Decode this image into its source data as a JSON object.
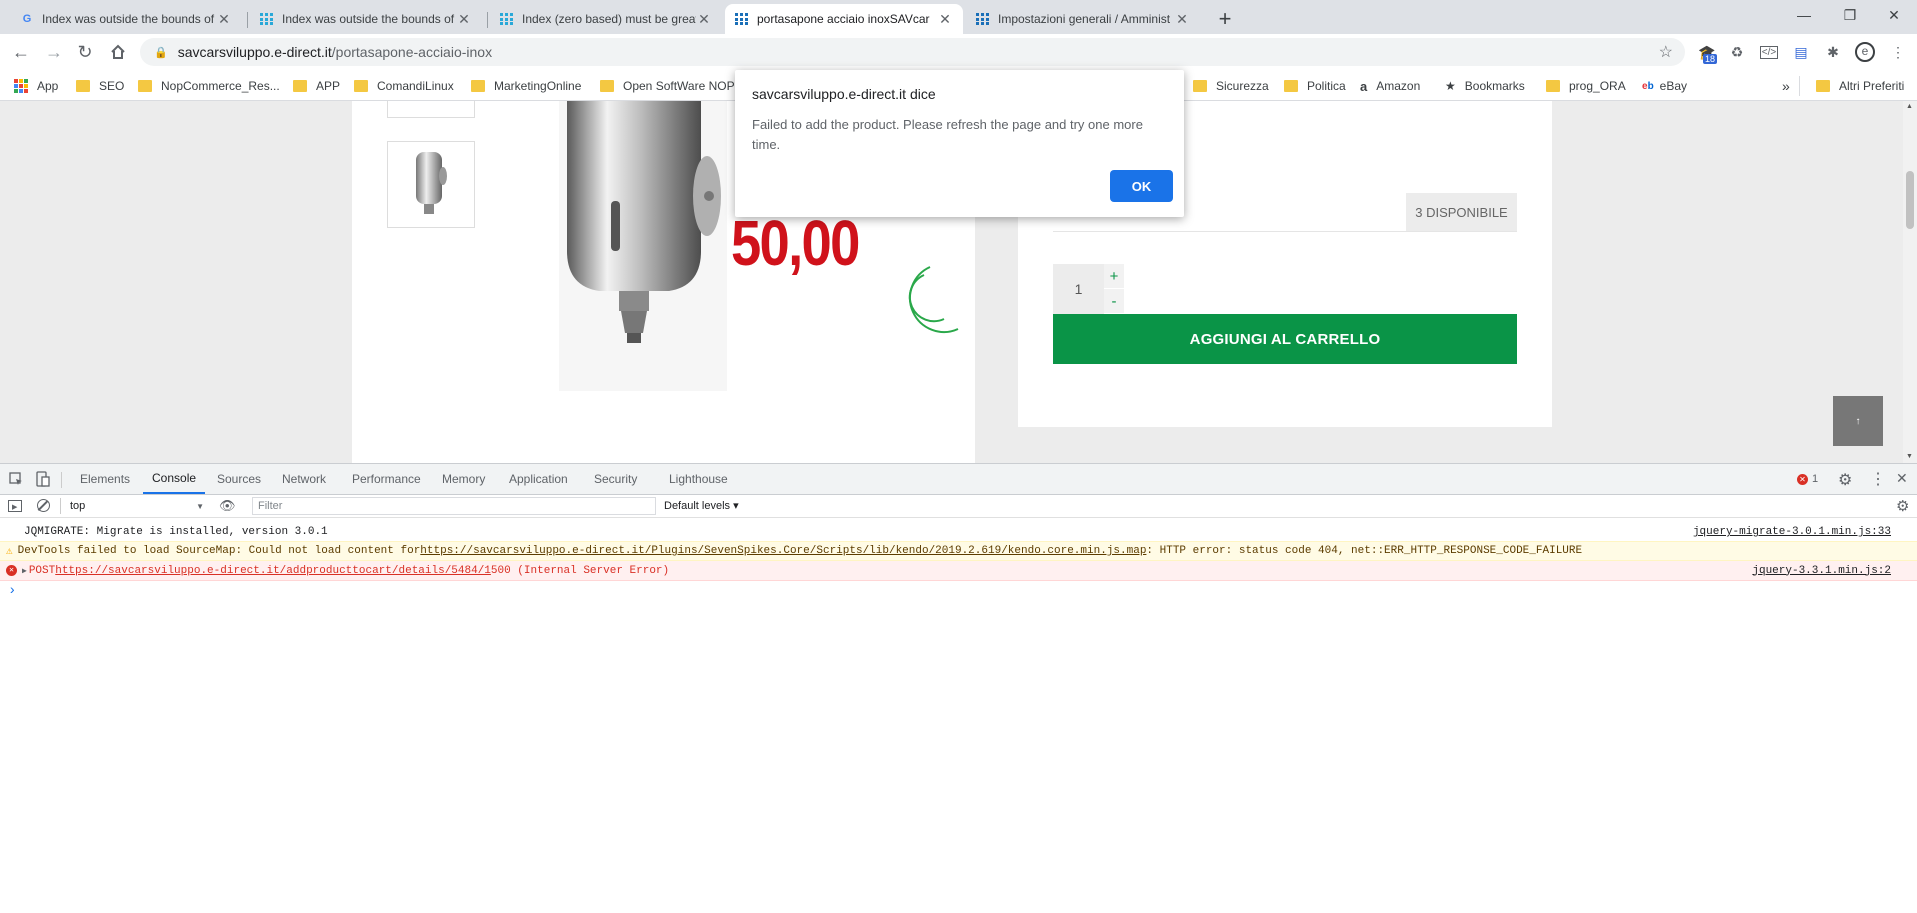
{
  "tabs": [
    {
      "title": "Index was outside the bounds of",
      "favicon": "google-icon"
    },
    {
      "title": "Index was outside the bounds of",
      "favicon": "grid-icon"
    },
    {
      "title": "Index (zero based) must be great",
      "favicon": "grid-icon"
    },
    {
      "title": "portasapone acciaio inoxSAVcar",
      "favicon": "grid-icon",
      "active": true
    },
    {
      "title": "Impostazioni generali / Amminist",
      "favicon": "grid-icon"
    }
  ],
  "address": {
    "host": "savcarsviluppo.e-direct.it",
    "path": "/portasapone-acciaio-inox"
  },
  "extensions": {
    "badge": "18"
  },
  "bookmarks": [
    {
      "label": "App",
      "type": "apps"
    },
    {
      "label": "SEO",
      "type": "folder"
    },
    {
      "label": "NopCommerce_Res...",
      "type": "folder"
    },
    {
      "label": "APP",
      "type": "folder"
    },
    {
      "label": "ComandiLinux",
      "type": "folder"
    },
    {
      "label": "MarketingOnline",
      "type": "folder"
    },
    {
      "label": "Open SoftWare NOP",
      "type": "folder"
    },
    {
      "label": "Sicurezza",
      "type": "folder"
    },
    {
      "label": "Politica",
      "type": "folder"
    },
    {
      "label": "Amazon",
      "type": "amazon"
    },
    {
      "label": "Bookmarks",
      "type": "star"
    },
    {
      "label": "prog_ORA",
      "type": "folder"
    },
    {
      "label": "eBay",
      "type": "ebay"
    }
  ],
  "bookmarks_more": "»",
  "other_bookmarks": "Altri Preferiti",
  "product": {
    "price_text": "50,00",
    "availability": "3 DISPONIBILE",
    "quantity": "1",
    "plus": "+",
    "minus": "-",
    "add_to_cart": "AGGIUNGI AL CARRELLO",
    "scroll_top": "↑"
  },
  "dialog": {
    "title": "savcarsviluppo.e-direct.it dice",
    "message": "Failed to add the product. Please refresh the page and try one more time.",
    "ok": "OK"
  },
  "devtools": {
    "tabs": [
      "Elements",
      "Console",
      "Sources",
      "Network",
      "Performance",
      "Memory",
      "Application",
      "Security",
      "Lighthouse"
    ],
    "active_tab": "Console",
    "error_count": "1",
    "context": "top",
    "filter_placeholder": "Filter",
    "levels": "Default levels ▾",
    "console": [
      {
        "level": "info",
        "text": "JQMIGRATE: Migrate is installed, version 3.0.1",
        "source": "jquery-migrate-3.0.1.min.js:33"
      },
      {
        "level": "warning",
        "prefix": "DevTools failed to load SourceMap: Could not load content for ",
        "url": "https://savcarsviluppo.e-direct.it/Plugins/SevenSpikes.Core/Scripts/lib/kendo/2019.2.619/kendo.core.min.js.map",
        "suffix": ": HTTP error: status code 404, net::ERR_HTTP_RESPONSE_CODE_FAILURE"
      },
      {
        "level": "error",
        "prefix": "POST ",
        "url": "https://savcarsviluppo.e-direct.it/addproducttocart/details/5484/1",
        "suffix": " 500 (Internal Server Error)",
        "source": "jquery-3.3.1.min.js:2"
      }
    ],
    "prompt": "›"
  },
  "colors": {
    "accent": "#1a73e8",
    "cart_green": "#0a9447",
    "price_red": "#d0121b",
    "error_red": "#d93025",
    "warning_bg": "#fffbe5"
  }
}
